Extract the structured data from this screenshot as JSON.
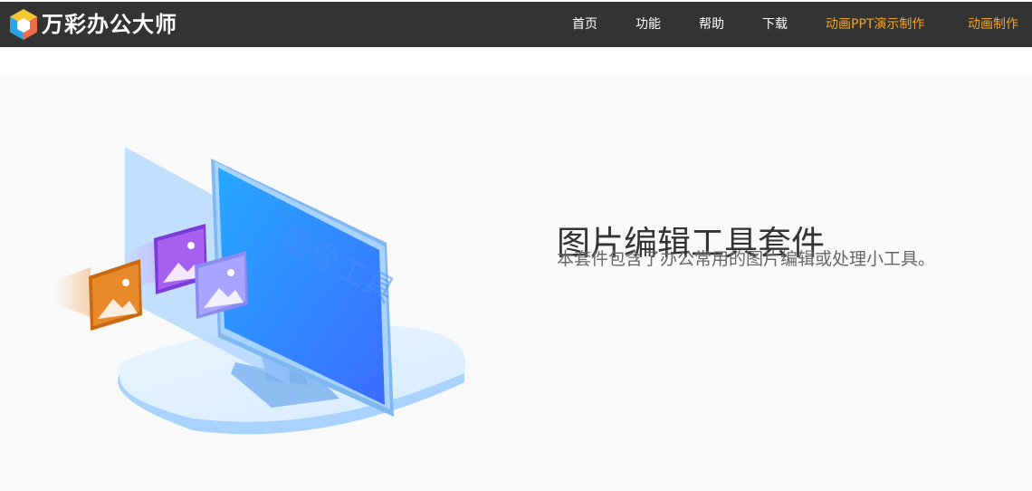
{
  "header": {
    "brand": "万彩办公大师",
    "logo_icon": "hexagon-cube-logo-icon",
    "nav": [
      {
        "label": "首页",
        "color": "#ffffff"
      },
      {
        "label": "功能",
        "color": "#ffffff"
      },
      {
        "label": "帮助",
        "color": "#ffffff"
      },
      {
        "label": "下载",
        "color": "#ffffff"
      },
      {
        "label": "动画PPT演示制作",
        "color": "#f5a623"
      },
      {
        "label": "动画制作",
        "color": "#f5a623"
      }
    ]
  },
  "hero": {
    "title": "图片编辑工具套件",
    "subtitle": "本套件包含了办公常用的图片编辑或处理小工具。",
    "illustration_text": "图像工具",
    "illustration_icon": "monitor-with-image-cards-illustration"
  },
  "colors": {
    "topbar": "#333333",
    "accent_orange": "#f5a623",
    "hero_bg": "#f9f9f9",
    "monitor_blue": "#2f7dff"
  }
}
